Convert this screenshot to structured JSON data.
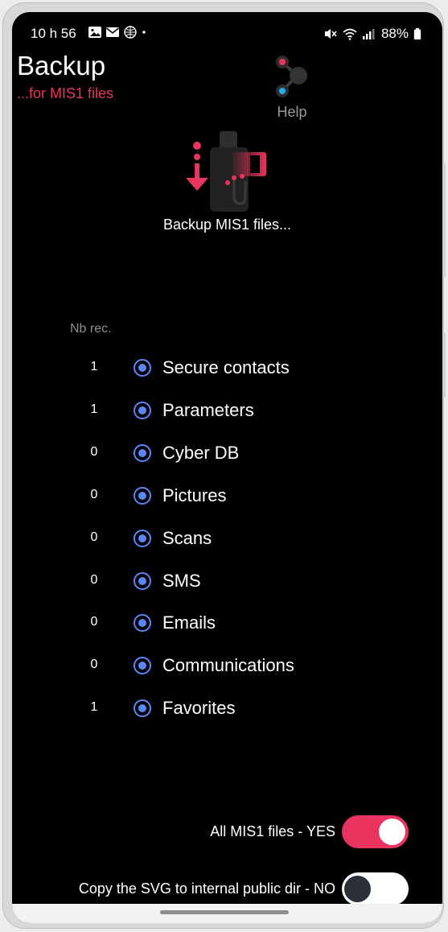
{
  "status_bar": {
    "time": "10 h 56",
    "left_icons": [
      "image-icon",
      "mail-icon",
      "globe-icon",
      "dot-icon"
    ],
    "right_icons": [
      "mute-icon",
      "wifi-icon",
      "signal-icon",
      "battery-icon"
    ],
    "battery": "88%"
  },
  "header": {
    "title": "Backup",
    "subtitle": "...for MIS1 files",
    "help_label": "Help"
  },
  "hero": {
    "label": "Backup MIS1 files..."
  },
  "list": {
    "count_header": "Nb rec.",
    "items": [
      {
        "count": "1",
        "label": "Secure contacts",
        "selected": true
      },
      {
        "count": "1",
        "label": "Parameters",
        "selected": true
      },
      {
        "count": "0",
        "label": "Cyber DB",
        "selected": true
      },
      {
        "count": "0",
        "label": "Pictures",
        "selected": true
      },
      {
        "count": "0",
        "label": "Scans",
        "selected": true
      },
      {
        "count": "0",
        "label": "SMS",
        "selected": true
      },
      {
        "count": "0",
        "label": "Emails",
        "selected": true
      },
      {
        "count": "0",
        "label": "Communications",
        "selected": true
      },
      {
        "count": "1",
        "label": "Favorites",
        "selected": true
      }
    ]
  },
  "toggles": {
    "all_files": {
      "label": "All MIS1 files - YES",
      "on": true
    },
    "copy_svg": {
      "label": "Copy the SVG to internal public dir - NO",
      "on": false
    }
  },
  "colors": {
    "accent": "#e8345f",
    "radio": "#5b87f5",
    "background": "#000000"
  }
}
